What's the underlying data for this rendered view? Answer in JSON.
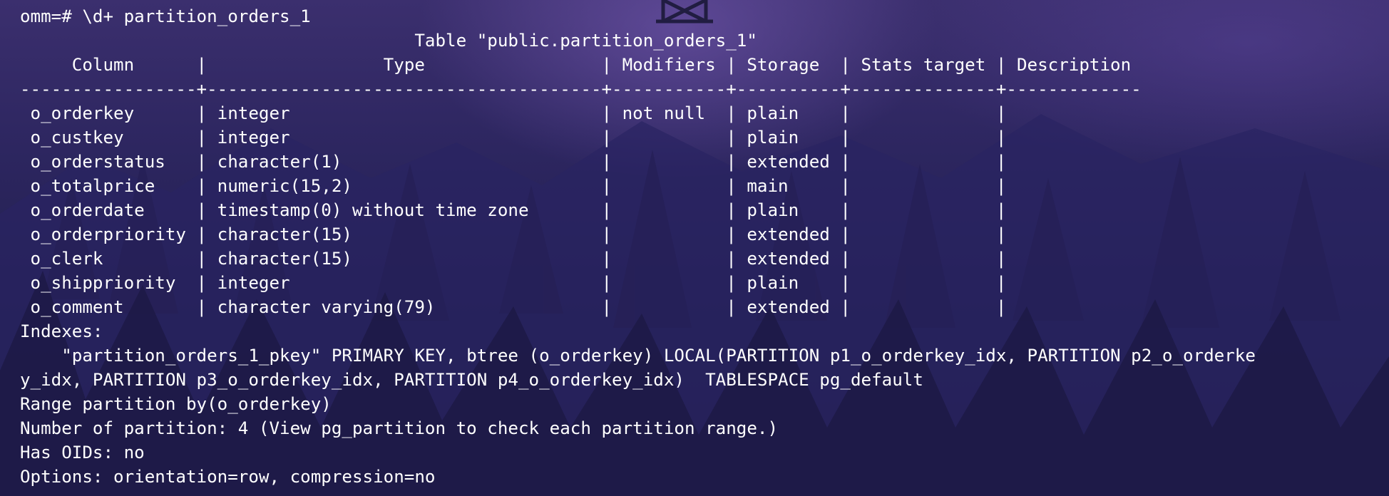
{
  "terminal": {
    "prompt_command": "omm=# \\d+ partition_orders_1",
    "table_title": "                                      Table \"public.partition_orders_1\"",
    "header": "     Column      |                 Type                 | Modifiers | Storage  | Stats target | Description",
    "separator": "-----------------+--------------------------------------+-----------+----------+--------------+-------------",
    "rows": [
      " o_orderkey      | integer                              | not null  | plain    |              |",
      " o_custkey       | integer                              |           | plain    |              |",
      " o_orderstatus   | character(1)                         |           | extended |              |",
      " o_totalprice    | numeric(15,2)                        |           | main     |              |",
      " o_orderdate     | timestamp(0) without time zone       |           | plain    |              |",
      " o_orderpriority | character(15)                        |           | extended |              |",
      " o_clerk         | character(15)                        |           | extended |              |",
      " o_shippriority  | integer                              |           | plain    |              |",
      " o_comment       | character varying(79)                |           | extended |              |"
    ],
    "indexes_label": "Indexes:",
    "index_line_1": "    \"partition_orders_1_pkey\" PRIMARY KEY, btree (o_orderkey) LOCAL(PARTITION p1_o_orderkey_idx, PARTITION p2_o_orderke",
    "index_line_2": "y_idx, PARTITION p3_o_orderkey_idx, PARTITION p4_o_orderkey_idx)  TABLESPACE pg_default",
    "range_partition": "Range partition by(o_orderkey)",
    "partition_count": "Number of partition: 4 (View pg_partition to check each partition range.)",
    "has_oids": "Has OIDs: no",
    "options": "Options: orientation=row, compression=no"
  },
  "colors": {
    "text": "#ffffff",
    "background": "#1a1640"
  }
}
